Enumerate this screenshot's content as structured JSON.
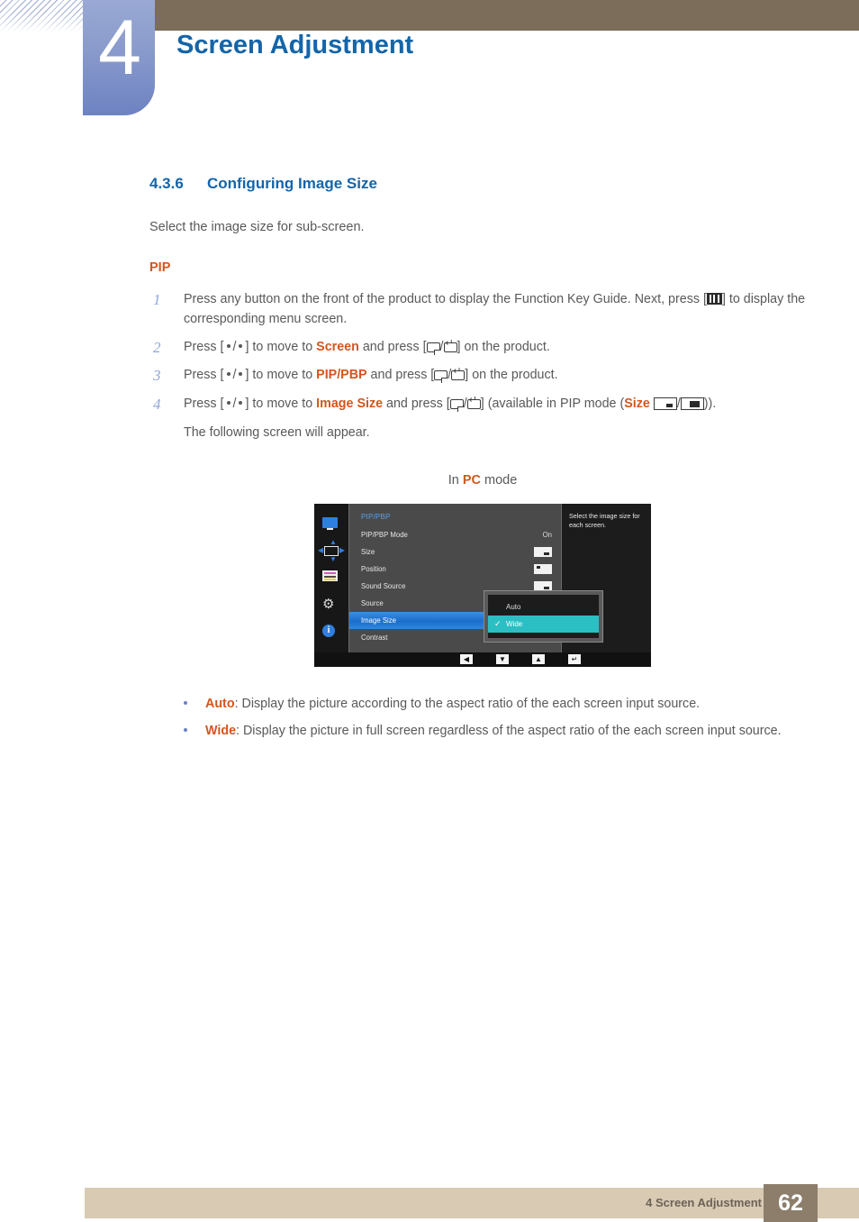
{
  "header": {
    "chapter_number": "4",
    "chapter_title": "Screen Adjustment"
  },
  "section": {
    "number": "4.3.6",
    "title": "Configuring Image Size",
    "lead": "Select the image size for sub-screen.",
    "subhead": "PIP"
  },
  "steps": [
    {
      "n": "1",
      "p1": "Press any button on the front of the product to display the Function Key Guide. Next, press [",
      "p2": "] to display the corresponding menu screen."
    },
    {
      "n": "2",
      "p1": "Press [",
      "p2": "] to move to ",
      "target": "Screen",
      "p3": " and press [",
      "p4": "] on the product."
    },
    {
      "n": "3",
      "p1": "Press [",
      "p2": "] to move to ",
      "target": "PIP/PBP",
      "p3": " and press [",
      "p4": "] on the product."
    },
    {
      "n": "4",
      "p1": "Press [",
      "p2": "] to move to ",
      "target": "Image Size",
      "p3": " and press [",
      "p4": "] (available in PIP mode (",
      "size_label": "Size",
      "p5": ")).",
      "p6": "The following screen will appear."
    }
  ],
  "mode_line": {
    "prefix": "In ",
    "mode": "PC",
    "suffix": " mode"
  },
  "osd": {
    "title": "PIP/PBP",
    "help_text": "Select the image size for each screen.",
    "rows": [
      {
        "label": "PIP/PBP Mode",
        "value": "On",
        "value_type": "text"
      },
      {
        "label": "Size",
        "value": "",
        "value_type": "box-a"
      },
      {
        "label": "Position",
        "value": "",
        "value_type": "box-b"
      },
      {
        "label": "Sound Source",
        "value": "",
        "value_type": "box-c"
      },
      {
        "label": "Source",
        "value": "",
        "value_type": "none"
      },
      {
        "label": "Image Size",
        "value": "",
        "value_type": "none",
        "selected": true
      },
      {
        "label": "Contrast",
        "value": "",
        "value_type": "none"
      }
    ],
    "submenu": [
      {
        "label": "Auto",
        "active": false
      },
      {
        "label": "Wide",
        "active": true
      }
    ],
    "side_icons": [
      "monitor-icon",
      "pip-pbp-icon",
      "picture-bars-icon",
      "gear-icon",
      "info-icon"
    ],
    "nav_buttons": [
      {
        "name": "nav-left",
        "glyph": "◀"
      },
      {
        "name": "nav-down",
        "glyph": "▼"
      },
      {
        "name": "nav-up",
        "glyph": "▲"
      },
      {
        "name": "nav-enter",
        "glyph": "↵"
      }
    ]
  },
  "bullets": [
    {
      "term": "Auto",
      "text": ": Display the picture according to the aspect ratio of the each screen input source."
    },
    {
      "term": "Wide",
      "text": ": Display the picture in full screen regardless of the aspect ratio of the each screen input source."
    }
  ],
  "footer": {
    "text": "4 Screen Adjustment",
    "page": "62"
  },
  "colors": {
    "accent_blue": "#1565a8",
    "accent_orange": "#d4561f",
    "chapter_tab": "#6d82c2",
    "header_band": "#7b6d59",
    "footer_band": "#d8cab3",
    "footer_page": "#8d7e6b",
    "osd_highlight": "#1a6ecb",
    "osd_active": "#2bbfc4"
  }
}
